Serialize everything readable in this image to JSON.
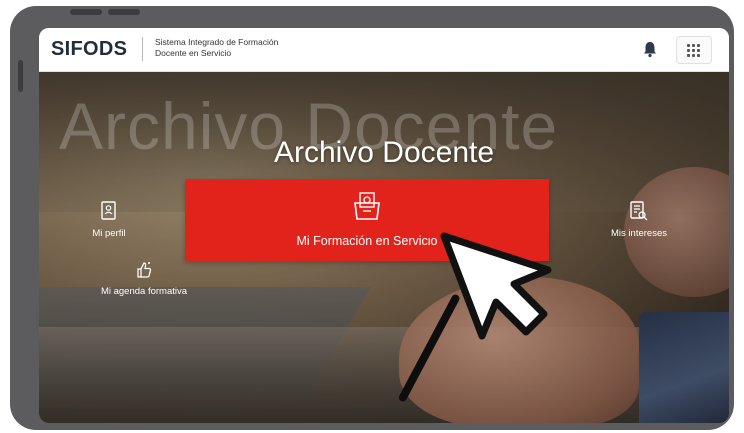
{
  "header": {
    "logo": "SIFODS",
    "subtitle_line1": "Sistema Integrado de Formación",
    "subtitle_line2": "Docente en Servicio",
    "icons": [
      "bell-icon",
      "apps-grid-icon"
    ]
  },
  "hero": {
    "watermark": "Archivo Docente",
    "title": "Archivo Docente"
  },
  "tiles": {
    "perfil": "Mi perfil",
    "main": "Mi Formación en Servicio",
    "intereses": "Mis intereses",
    "agenda": "Mi agenda formativa"
  },
  "colors": {
    "accent": "#e2231c",
    "frame": "#5c5c5e",
    "header_text": "#1f2d3d"
  }
}
